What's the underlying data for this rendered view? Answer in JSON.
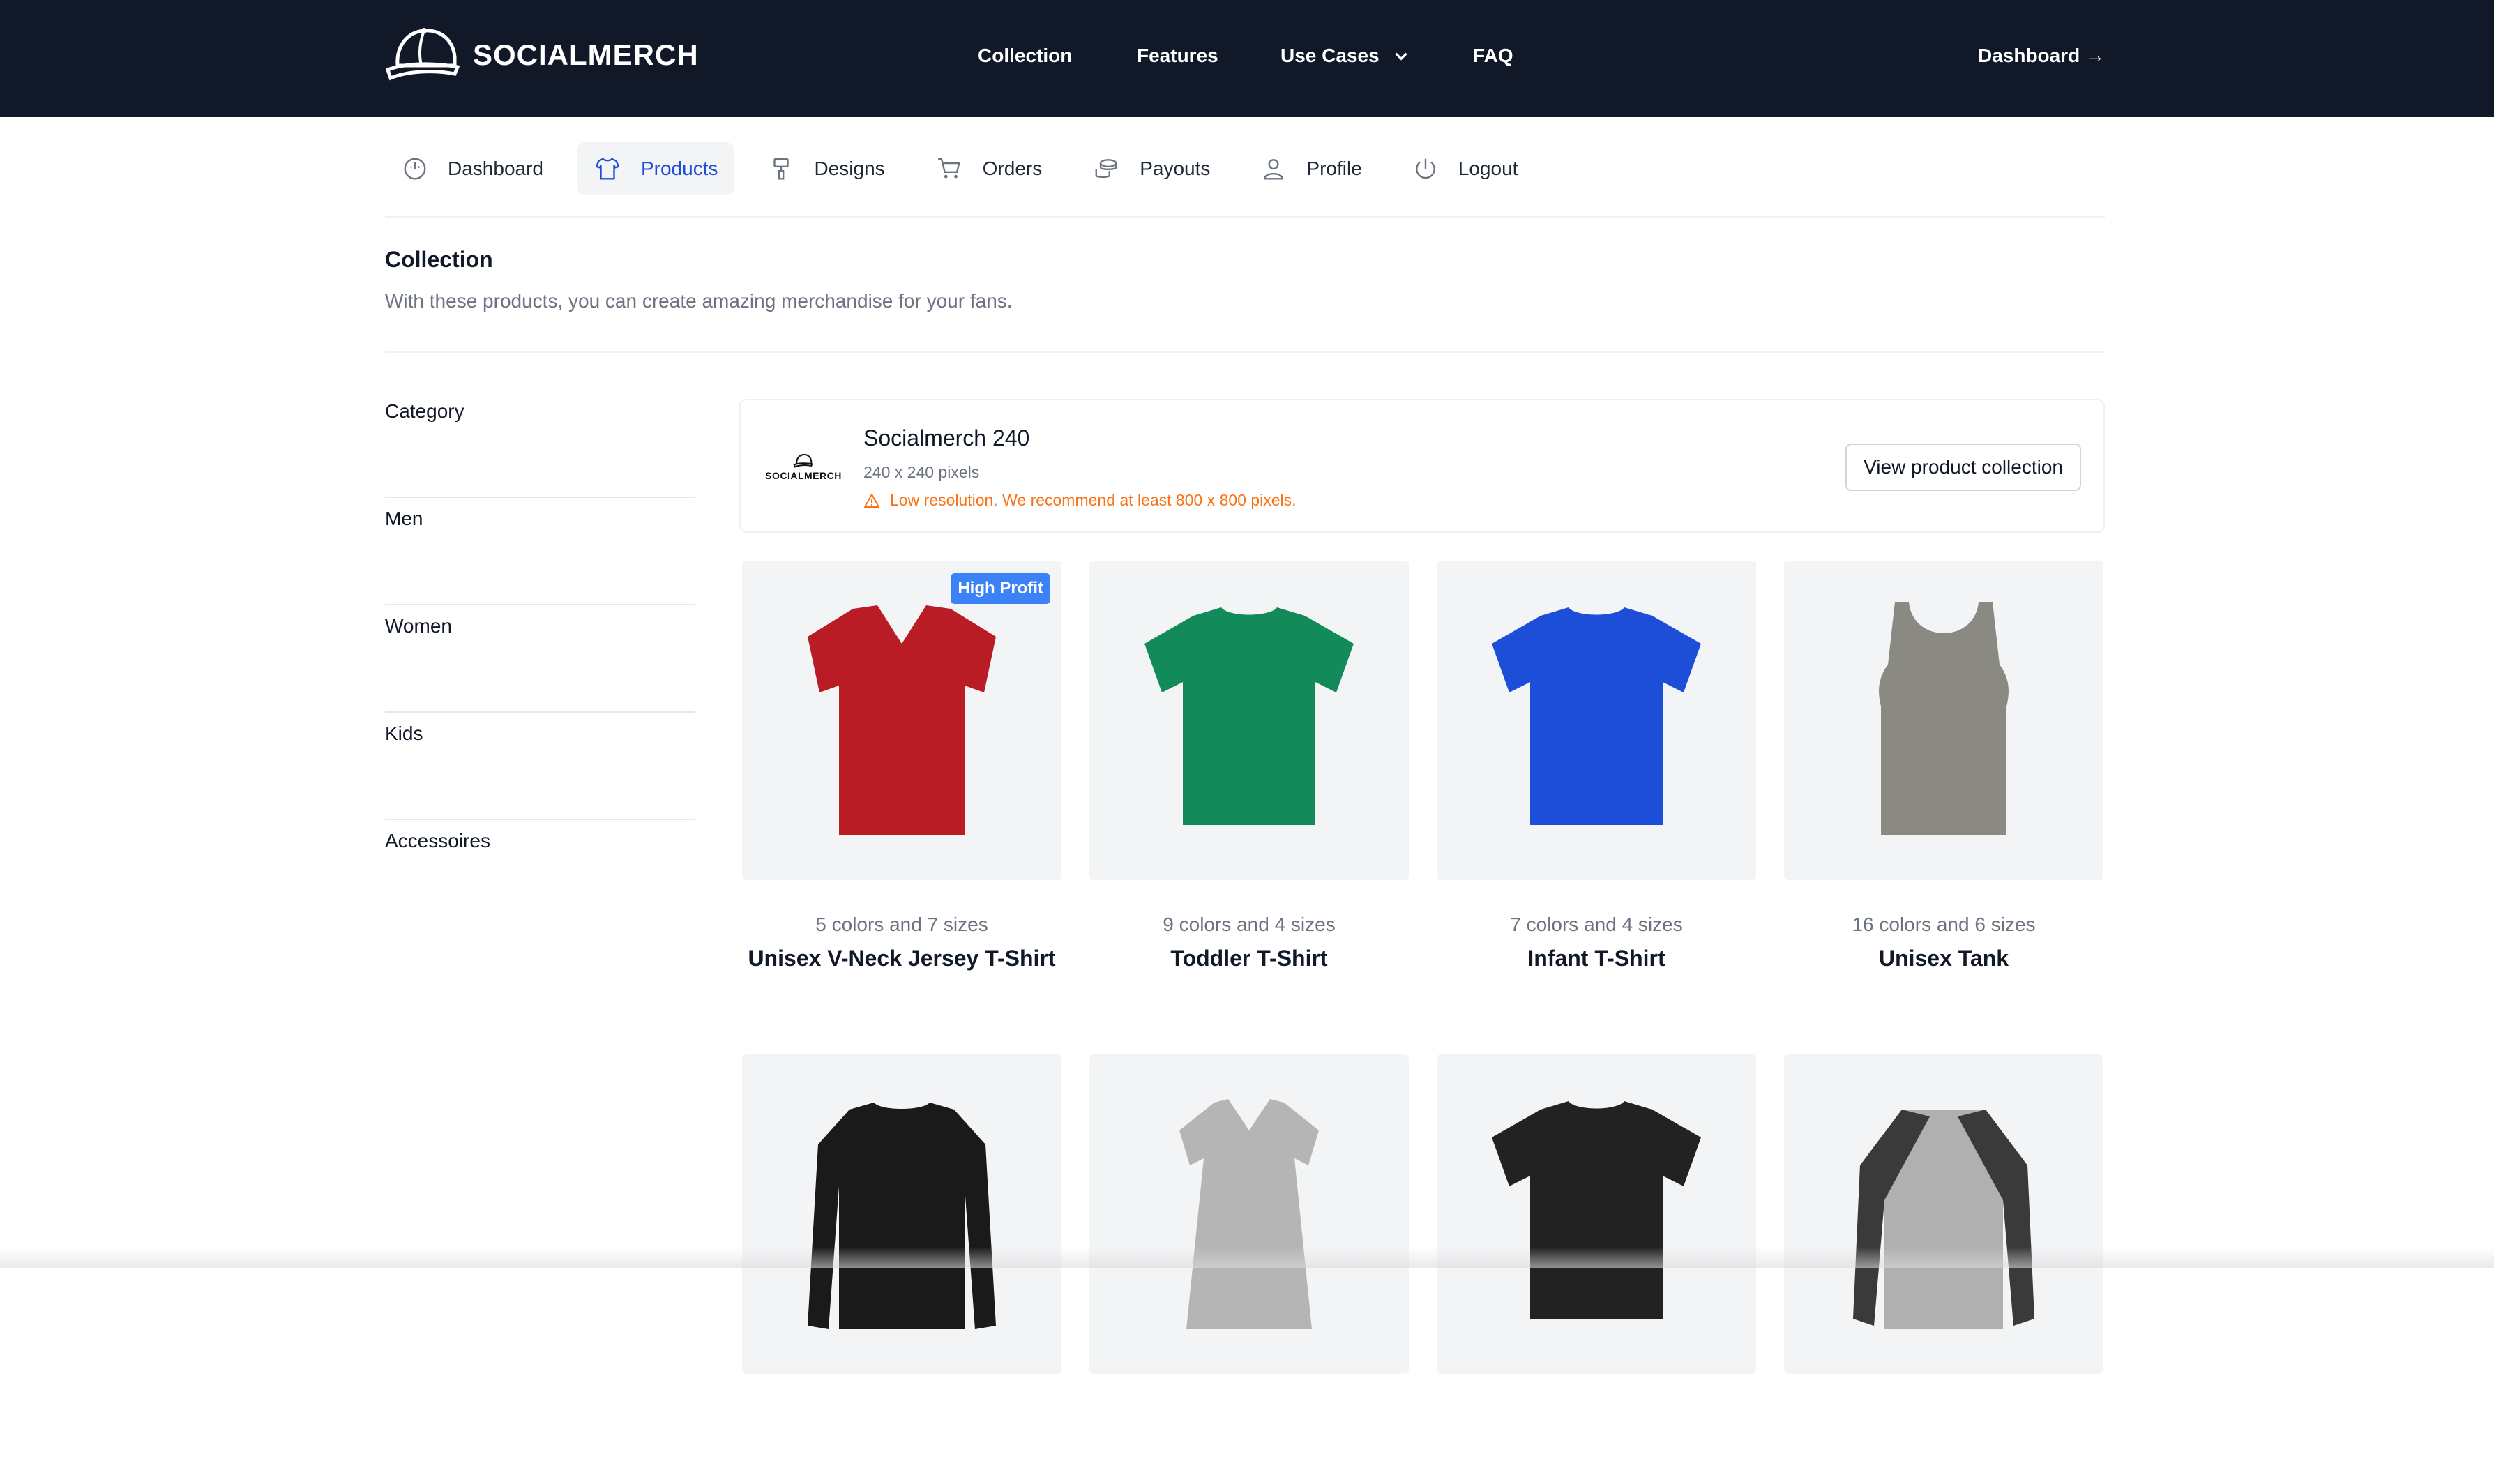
{
  "brand": {
    "name": "SOCIALMERCH"
  },
  "topnav": {
    "items": [
      "Collection",
      "Features",
      "Use Cases",
      "FAQ"
    ],
    "dashboard": "Dashboard →"
  },
  "subnav": {
    "tabs": [
      {
        "label": "Dashboard",
        "icon": "gauge-icon",
        "active": false
      },
      {
        "label": "Products",
        "icon": "tshirt-icon",
        "active": true
      },
      {
        "label": "Designs",
        "icon": "paint-roller-icon",
        "active": false
      },
      {
        "label": "Orders",
        "icon": "cart-icon",
        "active": false
      },
      {
        "label": "Payouts",
        "icon": "coins-icon",
        "active": false
      },
      {
        "label": "Profile",
        "icon": "user-icon",
        "active": false
      },
      {
        "label": "Logout",
        "icon": "power-icon",
        "active": false
      }
    ]
  },
  "header": {
    "title": "Collection",
    "subtitle": "With these products, you can create amazing merchandise for your fans."
  },
  "sidebar": {
    "items": [
      "Category",
      "Men",
      "Women",
      "Kids",
      "Accessoires"
    ]
  },
  "store": {
    "logo_text": "SOCIALMERCH",
    "name": "Socialmerch 240",
    "resolution": "240 x 240 pixels",
    "warning": "Low resolution. We recommend at least 800 x 800 pixels.",
    "button": "View product collection"
  },
  "products": [
    {
      "name": "Unisex V-Neck Jersey T-Shirt",
      "meta": "5 colors and 7 sizes",
      "badge": "High Profit",
      "color": "#b91c24",
      "style": "vneck"
    },
    {
      "name": "Toddler T-Shirt",
      "meta": "9 colors and 4 sizes",
      "badge": "",
      "color": "#138a5a",
      "style": "tee"
    },
    {
      "name": "Infant T-Shirt",
      "meta": "7 colors and 4 sizes",
      "badge": "",
      "color": "#1d4ed8",
      "style": "tee"
    },
    {
      "name": "Unisex Tank",
      "meta": "16 colors and 6 sizes",
      "badge": "",
      "color": "#8a8a82",
      "style": "tank"
    },
    {
      "name": "",
      "meta": "",
      "badge": "",
      "color": "#1a1a1a",
      "style": "longsleeve"
    },
    {
      "name": "",
      "meta": "",
      "badge": "",
      "color": "#b5b5b5",
      "style": "dress"
    },
    {
      "name": "",
      "meta": "",
      "badge": "",
      "color": "#222222",
      "style": "tee"
    },
    {
      "name": "",
      "meta": "",
      "badge": "",
      "color": "#b0b0b0",
      "style": "raglan"
    }
  ]
}
